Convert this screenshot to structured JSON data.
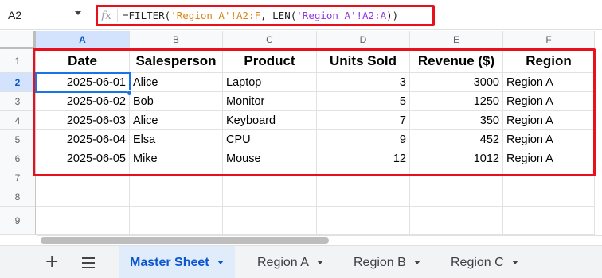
{
  "formula_bar": {
    "cell_ref": "A2",
    "fx_symbol": "fx",
    "formula_parts": {
      "prefix": "=FILTER(",
      "arg1": "'Region A'!A2:F",
      "mid": ", LEN(",
      "arg2": "'Region A'!A2:A",
      "suffix": "))"
    }
  },
  "grid": {
    "columns": [
      "A",
      "B",
      "C",
      "D",
      "E",
      "F"
    ],
    "rows": [
      "1",
      "2",
      "3",
      "4",
      "5",
      "6",
      "7",
      "8",
      "9"
    ],
    "active_cell": "A2",
    "headers": [
      "Date",
      "Salesperson",
      "Product",
      "Units Sold",
      "Revenue ($)",
      "Region"
    ],
    "data": [
      [
        "2025-06-01",
        "Alice",
        "Laptop",
        "3",
        "3000",
        "Region A"
      ],
      [
        "2025-06-02",
        "Bob",
        "Monitor",
        "5",
        "1250",
        "Region A"
      ],
      [
        "2025-06-03",
        "Alice",
        "Keyboard",
        "7",
        "350",
        "Region A"
      ],
      [
        "2025-06-04",
        "Elsa",
        "CPU",
        "9",
        "452",
        "Region A"
      ],
      [
        "2025-06-05",
        "Mike",
        "Mouse",
        "12",
        "1012",
        "Region A"
      ]
    ]
  },
  "sheet_tabs": {
    "add_icon": "plus-icon",
    "all_sheets_icon": "menu-icon",
    "tabs": [
      {
        "label": "Master Sheet",
        "active": true
      },
      {
        "label": "Region A",
        "active": false
      },
      {
        "label": "Region B",
        "active": false
      },
      {
        "label": "Region C",
        "active": false
      }
    ]
  },
  "colors": {
    "highlight_red": "#e8101a",
    "selection_blue": "#1a73e8",
    "active_tab_bg": "#e1ecfb",
    "formula_string": "#d98316",
    "formula_range": "#9334e6"
  }
}
